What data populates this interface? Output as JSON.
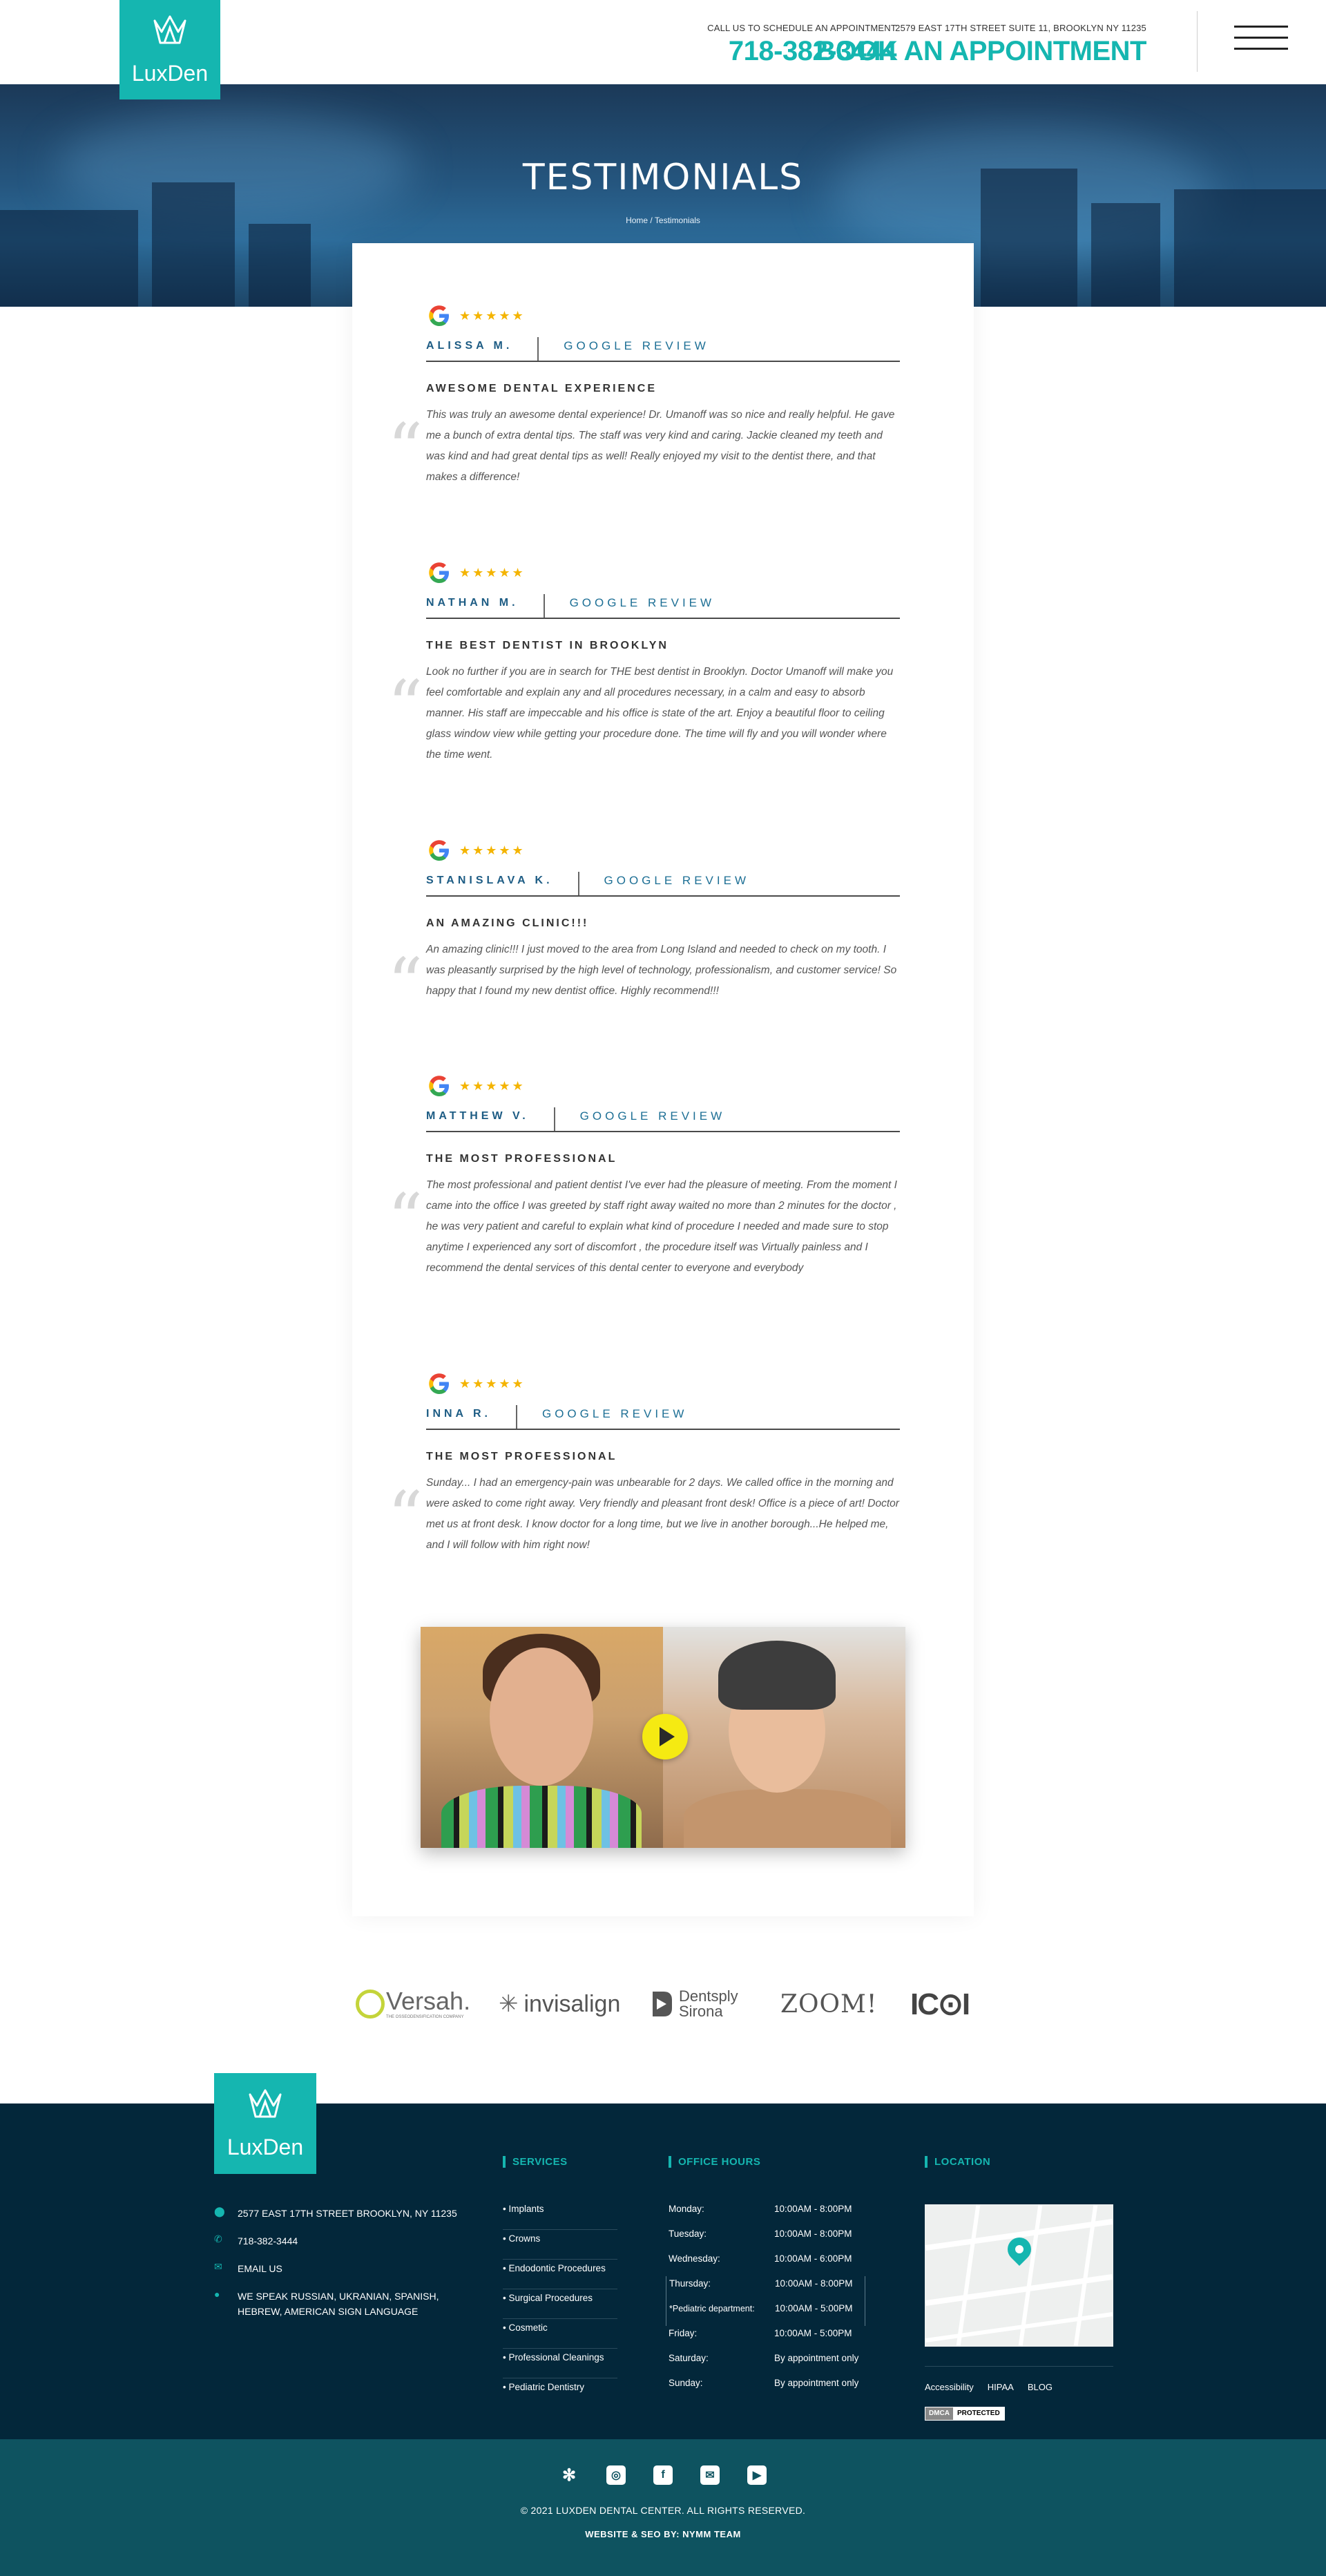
{
  "brand": {
    "name": "LuxDen",
    "accent": "#15b6b0",
    "footer_bg": "#03273a",
    "bottom_bg": "#0e5360"
  },
  "header": {
    "call_label": "CALL US TO SCHEDULE AN APPOINTMENT",
    "phone": "718-382-3444",
    "address": "2579 EAST 17TH STREET SUITE 11, BROOKLYN NY 11235",
    "book_label": "BOOK AN APPOINTMENT",
    "menu_icon": "hamburger-icon"
  },
  "hero": {
    "title": "TESTIMONIALS",
    "breadcrumb_home": "Home",
    "breadcrumb_sep": " / ",
    "breadcrumb_current": "Testimonials"
  },
  "reviews": [
    {
      "stars": "★★★★★",
      "name": "ALISSA M.",
      "source": "GOOGLE REVIEW",
      "title": "AWESOME DENTAL EXPERIENCE",
      "text": "This was truly an awesome dental experience! Dr. Umanoff was so nice and really helpful. He gave me a bunch of extra dental tips. The staff was very kind and caring. Jackie cleaned my teeth and was kind and had great dental tips as well! Really enjoyed my visit to the dentist there, and that makes a difference!"
    },
    {
      "stars": "★★★★★",
      "name": "NATHAN M.",
      "source": "GOOGLE REVIEW",
      "title": "THE BEST DENTIST IN BROOKLYN",
      "text": "Look no further if you are in search for THE best dentist in Brooklyn. Doctor Umanoff will make you feel comfortable and explain any and all procedures necessary, in a calm and easy to absorb manner. His staff are impeccable and his office is state of the art. Enjoy a beautiful floor to ceiling glass window view while getting your procedure done. The time will fly and you will wonder where the time went."
    },
    {
      "stars": "★★★★★",
      "name": "STANISLAVA K.",
      "source": "GOOGLE REVIEW",
      "title": "AN AMAZING CLINIC!!!",
      "text": "An amazing clinic!!! I just moved to the area from Long Island and needed to check on my tooth. I was pleasantly surprised by the high level of technology, professionalism, and customer service! So happy that I found my new dentist office. Highly recommend!!!"
    },
    {
      "stars": "★★★★★",
      "name": "MATTHEW V.",
      "source": "GOOGLE REVIEW",
      "title": "THE MOST PROFESSIONAL",
      "text": "The most professional and patient dentist I've ever had the pleasure of meeting. From the moment I came into the office I was greeted by staff right away waited no more than 2 minutes for the doctor , he was very patient and careful to explain what kind of procedure I needed and made sure to stop anytime I experienced any sort of discomfort , the procedure itself was Virtually painless and I recommend the dental services of this dental center to everyone and everybody"
    },
    {
      "stars": "★★★★★",
      "name": "INNA R.",
      "source": "GOOGLE REVIEW",
      "title": "THE MOST PROFESSIONAL",
      "text": "Sunday... I had an emergency-pain was unbearable for 2 days. We called office in the morning and were asked to come right away. Very friendly and pleasant front desk! Office is a piece of art! Doctor met us at front desk. I know doctor for a long time, but we live in another borough...He helped me, and I will follow with him right now!"
    }
  ],
  "partners": {
    "versah": "Versah.",
    "versah_sub": "THE OSSEODENSIFICATION COMPANY",
    "invisalign": "invisalign",
    "dentsply_1": "Dentsply",
    "dentsply_2": "Sirona",
    "zoom": "ZOOM!",
    "ici": "IC⊙I"
  },
  "footer": {
    "address": "2577 EAST 17TH STREET BROOKLYN, NY 11235",
    "phone": "718-382-3444",
    "email": "EMAIL US",
    "languages_1": "WE SPEAK RUSSIAN, UKRANIAN, SPANISH,",
    "languages_2": "HEBREW, AMERICAN SIGN LANGUAGE",
    "services_title": "SERVICES",
    "services": [
      "• Implants",
      "• Crowns",
      "• Endodontic Procedures",
      "• Surgical Procedures",
      "• Cosmetic",
      "• Professional Cleanings",
      "• Pediatric Dentistry"
    ],
    "hours_title": "OFFICE HOURS",
    "hours": [
      {
        "day": "Monday:",
        "time": "10:00AM - 8:00PM"
      },
      {
        "day": "Tuesday:",
        "time": "10:00AM - 8:00PM"
      },
      {
        "day": "Wednesday:",
        "time": "10:00AM - 6:00PM"
      },
      {
        "day": "Thursday:",
        "time": "10:00AM - 8:00PM"
      },
      {
        "day": "*Pediatric department:",
        "time": "10:00AM - 5:00PM"
      },
      {
        "day": "Friday:",
        "time": "10:00AM - 5:00PM"
      },
      {
        "day": "Saturday:",
        "time": "By appointment only"
      },
      {
        "day": "Sunday:",
        "time": "By appointment only"
      }
    ],
    "location_title": "LOCATION",
    "links": [
      "Accessibility",
      "HIPAA",
      "BLOG"
    ],
    "dmca_a": "DMCA",
    "dmca_b": "PROTECTED",
    "social_icons": [
      "yelp-icon",
      "instagram-icon",
      "facebook-icon",
      "email-icon",
      "youtube-icon"
    ],
    "copyright": "© 2021 LUXDEN DENTAL CENTER. ALL RIGHTS RESERVED.",
    "credit": "WEBSITE & SEO BY: NYMM TEAM"
  }
}
